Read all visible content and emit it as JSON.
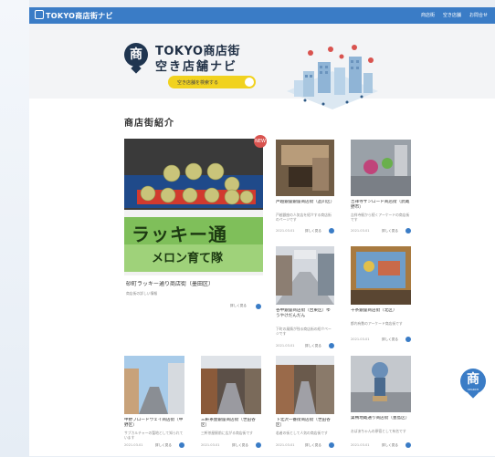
{
  "topbar": {
    "brand": "TOKYO商店街ナビ",
    "nav": [
      "商店街",
      "空き店舗",
      "お問合せ"
    ]
  },
  "hero": {
    "title_line1": "TOKYO商店街",
    "title_line2": "空き店舗ナビ",
    "button_label": "空き店舗を検索する",
    "logo_glyph": "商"
  },
  "section": {
    "title": "商店街紹介"
  },
  "featured": {
    "title": "砂町ラッキー通り商店街（墨田区）",
    "sub": "商店街の詳しい情報",
    "more": "詳しく見る",
    "badge": "NEW",
    "banner_text": "ラッキー通",
    "banner_sub": "メロン育て隊"
  },
  "cards": [
    {
      "title": "戸越銀座銀座商店街（品川区）",
      "sub": "戸越銀座の人気店を紹介する商店街のページです",
      "date": "2021.03.01",
      "more": "詳しく見る"
    },
    {
      "title": "吉祥寺サンロード商店街（武蔵野市）",
      "sub": "吉祥寺駅から続くアーケードの商店街です",
      "date": "2021.03.01",
      "more": "詳しく見る"
    },
    {
      "title": "谷中銀座商店街（台東区）ゆうやけだんだん",
      "sub": "下町の風情が残る商店街の紹介ページです",
      "date": "2021.03.01",
      "more": "詳しく見る"
    },
    {
      "title": "十条銀座商店街（北区）",
      "sub": "都内有数のアーケード商店街です",
      "date": "2021.03.01",
      "more": "詳しく見る"
    },
    {
      "title": "中野ブロードウェイ商店街（中野区）",
      "sub": "サブカルチャーの聖地として知られています",
      "date": "2021.03.01",
      "more": "詳しく見る"
    },
    {
      "title": "三軒茶屋銀座商店街（世田谷区）",
      "sub": "三軒茶屋駅前に広がる商店街です",
      "date": "2021.03.01",
      "more": "詳しく見る"
    },
    {
      "title": "下北沢一番街商店街（世田谷区）",
      "sub": "若者の街として人気の商店街です",
      "date": "2021.03.01",
      "more": "詳しく見る"
    },
    {
      "title": "巣鴨地蔵通り商店街（豊島区）",
      "sub": "おばあちゃんの原宿として有名です",
      "date": "2021.03.01",
      "more": "詳しく見る"
    }
  ],
  "fab": {
    "glyph": "商",
    "label": "SEARCH"
  },
  "colors": {
    "primary": "#3a7cc6",
    "accent": "#f1d21f",
    "navy": "#1f3550",
    "badge": "#d9534f"
  }
}
